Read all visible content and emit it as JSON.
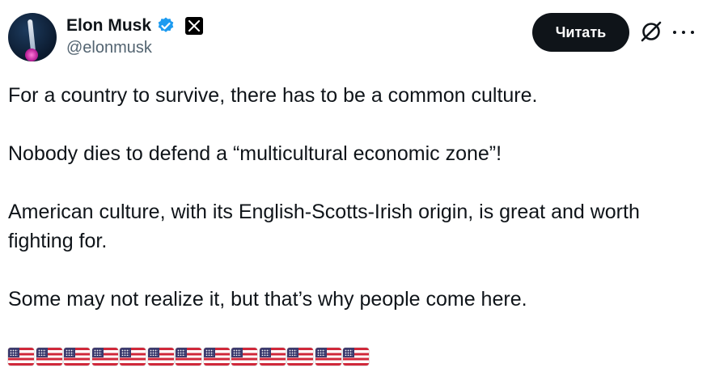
{
  "author": {
    "display_name": "Elon Musk",
    "handle": "@elonmusk",
    "verified": true,
    "verified_color": "#1d9bf0",
    "affiliation_icon": "x-logo-icon"
  },
  "actions": {
    "follow_label": "Читать",
    "grok_icon": "grok-icon",
    "more_icon": "more-dots-icon"
  },
  "tweet": {
    "paragraphs": [
      "For a country to survive, there has to be a common culture.",
      "Nobody dies to defend a “multicultural economic zone”!",
      "American culture, with its English-Scotts-Irish origin, is great and worth fighting for.",
      "Some may not realize it, but that’s why people come here."
    ],
    "flag_emoji": "🇺🇸",
    "flag_count": 13
  }
}
